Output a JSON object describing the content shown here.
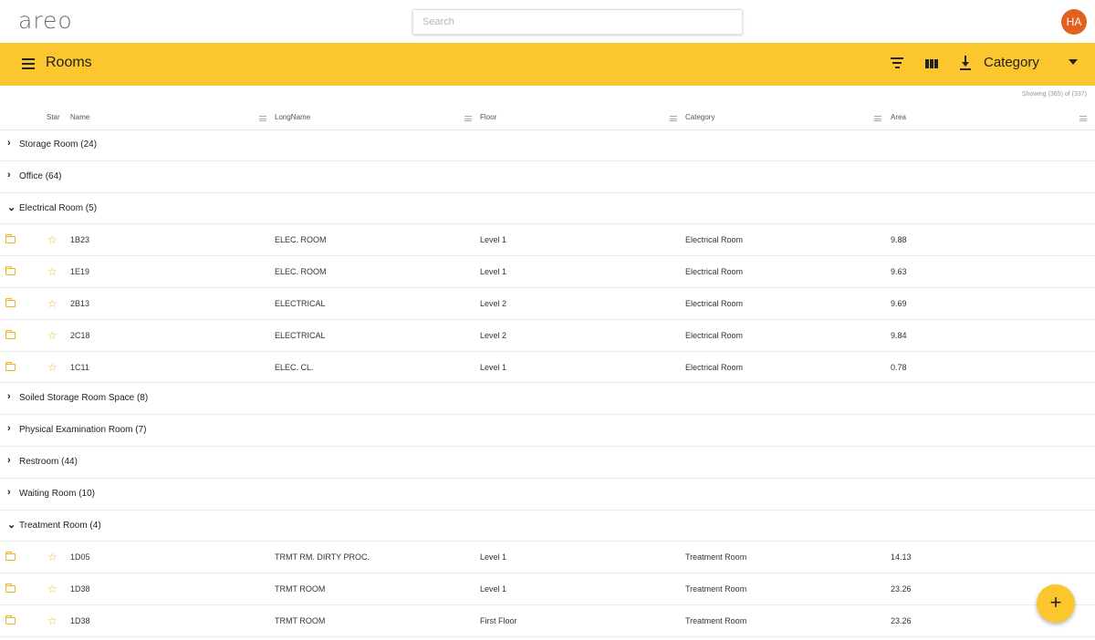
{
  "app": {
    "logo": "areo"
  },
  "search": {
    "placeholder": "Search"
  },
  "user": {
    "initials": "HA",
    "color": "#e2611f"
  },
  "toolbar": {
    "title": "Rooms",
    "group_by": "Category",
    "accent": "#fcc62e",
    "icons": [
      "menu-icon",
      "filter-icon",
      "columns-icon",
      "download-icon"
    ]
  },
  "table": {
    "showing": "Showing (365) of (337)",
    "columns": [
      "Star",
      "Name",
      "LongName",
      "Floor",
      "Category",
      "Area"
    ],
    "rows": [
      {
        "type": "group",
        "label": "Storage Room (24)",
        "expanded": false
      },
      {
        "type": "group",
        "label": "Office (64)",
        "expanded": false
      },
      {
        "type": "group",
        "label": "Electrical Room (5)",
        "expanded": true
      },
      {
        "type": "item",
        "name": "1B23",
        "longname": "ELEC. ROOM",
        "floor": "Level 1",
        "category": "Electrical Room",
        "area": "9.88"
      },
      {
        "type": "item",
        "name": "1E19",
        "longname": "ELEC. ROOM",
        "floor": "Level 1",
        "category": "Electrical Room",
        "area": "9.63"
      },
      {
        "type": "item",
        "name": "2B13",
        "longname": "ELECTRICAL",
        "floor": "Level 2",
        "category": "Electrical Room",
        "area": "9.69"
      },
      {
        "type": "item",
        "name": "2C18",
        "longname": "ELECTRICAL",
        "floor": "Level 2",
        "category": "Electrical Room",
        "area": "9.84"
      },
      {
        "type": "item",
        "name": "1C11",
        "longname": "ELEC. CL.",
        "floor": "Level 1",
        "category": "Electrical Room",
        "area": "0.78"
      },
      {
        "type": "group",
        "label": "Soiled Storage Room Space (8)",
        "expanded": false
      },
      {
        "type": "group",
        "label": "Physical Examination Room (7)",
        "expanded": false
      },
      {
        "type": "group",
        "label": "Restroom (44)",
        "expanded": false
      },
      {
        "type": "group",
        "label": "Waiting Room (10)",
        "expanded": false
      },
      {
        "type": "group",
        "label": "Treatment Room (4)",
        "expanded": true
      },
      {
        "type": "item",
        "name": "1D05",
        "longname": "TRMT RM. DIRTY PROC.",
        "floor": "Level 1",
        "category": "Treatment Room",
        "area": "14.13"
      },
      {
        "type": "item",
        "name": "1D38",
        "longname": "TRMT ROOM",
        "floor": "Level 1",
        "category": "Treatment Room",
        "area": "23.26"
      },
      {
        "type": "item",
        "name": "1D38",
        "longname": "TRMT ROOM",
        "floor": "First Floor",
        "category": "Treatment Room",
        "area": "23.26"
      }
    ]
  },
  "fab": {
    "label": "+"
  }
}
